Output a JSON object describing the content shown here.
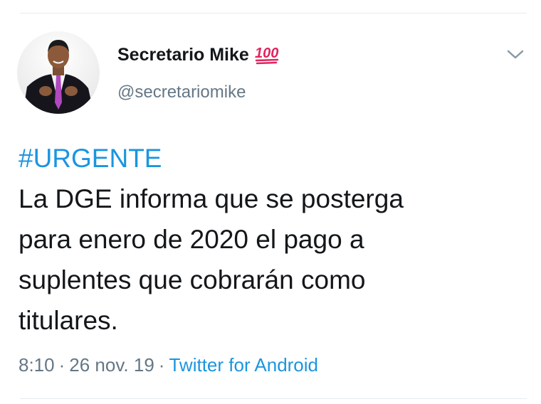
{
  "author": {
    "display_name": "Secretario Mike",
    "username": "@secretariomike",
    "badge_icon": "hundred-points-emoji"
  },
  "tweet": {
    "hashtag": "#URGENTE",
    "lines": [
      "La DGE informa que se posterga",
      "para enero de 2020 el pago a",
      "suplentes que cobrarán como",
      "titulares."
    ]
  },
  "meta": {
    "time": "8:10",
    "separator": "·",
    "date": "26 nov. 19",
    "source": "Twitter for Android"
  },
  "colors": {
    "link": "#1b95e0",
    "secondary": "#657786",
    "text": "#14171a",
    "divider": "#e6ecf0"
  },
  "icons": {
    "menu": "chevron-down-icon"
  }
}
